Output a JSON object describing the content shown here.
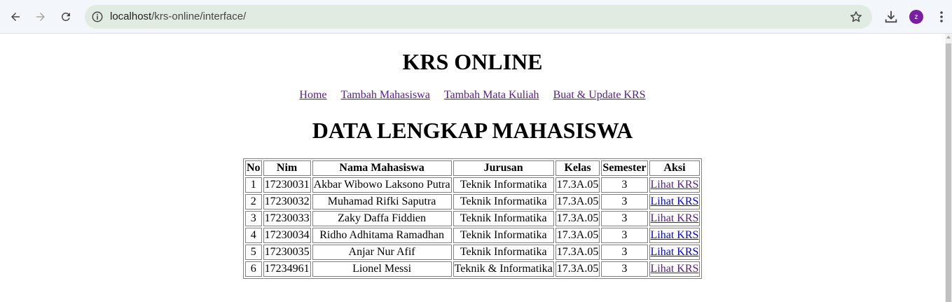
{
  "browser": {
    "url_host": "localhost",
    "url_path": "/krs-online/interface/",
    "profile_initial": "z",
    "profile_color": "#7b1fa2"
  },
  "page": {
    "site_title": "KRS ONLINE",
    "menu": [
      {
        "label": "Home"
      },
      {
        "label": "Tambah Mahasiswa"
      },
      {
        "label": "Tambah Mata Kuliah"
      },
      {
        "label": "Buat & Update KRS"
      }
    ],
    "section_title": "DATA LENGKAP MAHASISWA",
    "table": {
      "headers": [
        "No",
        "Nim",
        "Nama Mahasiswa",
        "Jurusan",
        "Kelas",
        "Semester",
        "Aksi"
      ],
      "rows": [
        {
          "no": "1",
          "nim": "17230031",
          "nama": "Akbar Wibowo Laksono Putra",
          "jurusan": "Teknik Informatika",
          "kelas": "17.3A.05",
          "semester": "3",
          "aksi": "Lihat KRS"
        },
        {
          "no": "2",
          "nim": "17230032",
          "nama": "Muhamad Rifki Saputra",
          "jurusan": "Teknik Informatika",
          "kelas": "17.3A.05",
          "semester": "3",
          "aksi": "Lihat KRS"
        },
        {
          "no": "3",
          "nim": "17230033",
          "nama": "Zaky Daffa Fiddien",
          "jurusan": "Teknik Informatika",
          "kelas": "17.3A.05",
          "semester": "3",
          "aksi": "Lihat KRS"
        },
        {
          "no": "4",
          "nim": "17230034",
          "nama": "Ridho Adhitama Ramadhan",
          "jurusan": "Teknik Informatika",
          "kelas": "17.3A.05",
          "semester": "3",
          "aksi": "Lihat KRS"
        },
        {
          "no": "5",
          "nim": "17230035",
          "nama": "Anjar Nur Afif",
          "jurusan": "Teknik Informatika",
          "kelas": "17.3A.05",
          "semester": "3",
          "aksi": "Lihat KRS"
        },
        {
          "no": "6",
          "nim": "17234961",
          "nama": "Lionel Messi",
          "jurusan": "Teknik & Informatika",
          "kelas": "17.3A.05",
          "semester": "3",
          "aksi": "Lihat KRS"
        }
      ]
    }
  }
}
